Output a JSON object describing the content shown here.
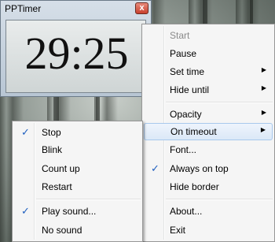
{
  "window": {
    "title": "PPTimer",
    "close_glyph": "x",
    "time": "29:25"
  },
  "main_menu": {
    "items": [
      {
        "label": "Start",
        "disabled": true
      },
      {
        "label": "Pause"
      },
      {
        "label": "Set time",
        "submenu": true
      },
      {
        "label": "Hide until",
        "submenu": true
      },
      {
        "label": "Opacity",
        "submenu": true
      },
      {
        "label": "On timeout",
        "submenu": true,
        "highlighted": true
      },
      {
        "label": "Font..."
      },
      {
        "label": "Always on top",
        "checked": true
      },
      {
        "label": "Hide border"
      },
      {
        "label": "About..."
      },
      {
        "label": "Exit"
      }
    ]
  },
  "timeout_menu": {
    "items": [
      {
        "label": "Stop",
        "checked": true
      },
      {
        "label": "Blink"
      },
      {
        "label": "Count up"
      },
      {
        "label": "Restart"
      },
      {
        "label": "Play sound...",
        "checked": true
      },
      {
        "label": "No sound"
      }
    ]
  },
  "colors": {
    "menu_bg": "#f5f5f5",
    "highlight_border": "#a8c8ec",
    "check": "#1f5fbf"
  }
}
